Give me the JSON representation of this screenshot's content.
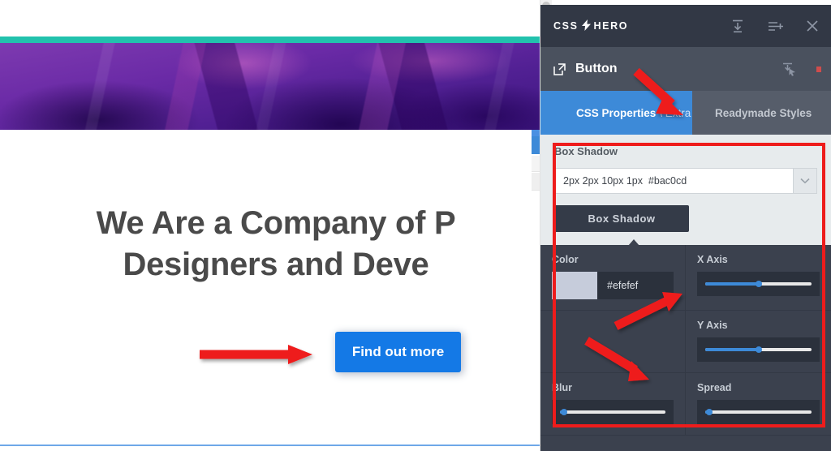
{
  "webpage": {
    "heading_line1": "We Are a Company of P",
    "heading_line2": "Designers and Deve",
    "cta_label": "Find out more",
    "accent_teal": "#22c2ad",
    "hero_purple": "#5e259c",
    "cta_blue": "#1479e6",
    "heading_color": "#4a4a4a"
  },
  "panel": {
    "brand_left": "CSS",
    "brand_bolt": "⚡",
    "brand_right": "HERO",
    "header_icons": [
      {
        "name": "save-to-bottom-icon",
        "title": "Save"
      },
      {
        "name": "list-plus-icon",
        "title": "Add"
      },
      {
        "name": "close-icon",
        "title": "Close"
      }
    ],
    "element": {
      "open_icon": "external-link-icon",
      "label": "Button",
      "select_icon": "cursor-select-icon",
      "status_color": "#cf4c4c"
    },
    "tabs": [
      {
        "label": "CSS Properties",
        "sublabel": "\\ Extra",
        "active": true
      },
      {
        "label": "Readymade Styles",
        "sublabel": "",
        "active": false
      }
    ],
    "box_shadow": {
      "section_title": "Box Shadow",
      "input_value": "2px 2px 10px 1px  #bac0cd",
      "input_placeholder": "none",
      "dropdown_icon": "chevron-down-icon",
      "button_label": "Box Shadow"
    },
    "controls": [
      {
        "label": "Color",
        "type": "color",
        "swatch": "#c6ccdb",
        "value": "#efefef"
      },
      {
        "label": "X Axis",
        "type": "slider",
        "percent": 50
      },
      {
        "label": "",
        "type": "empty"
      },
      {
        "label": "Y Axis",
        "type": "slider",
        "percent": 50
      },
      {
        "label": "Blur",
        "type": "slider",
        "percent": 4
      },
      {
        "label": "Spread",
        "type": "slider",
        "percent": 4
      }
    ]
  },
  "annotations": {
    "highlight_color": "#ee1c1c",
    "arrows": [
      {
        "name": "arrow-to-cta-button",
        "direction": "right"
      },
      {
        "name": "arrow-to-extra-tab",
        "direction": "down-right"
      },
      {
        "name": "arrow-to-x-axis",
        "direction": "up-right"
      },
      {
        "name": "arrow-to-blur",
        "direction": "down-right"
      }
    ],
    "highlight_box": {
      "name": "box-shadow-panel-highlight"
    }
  }
}
